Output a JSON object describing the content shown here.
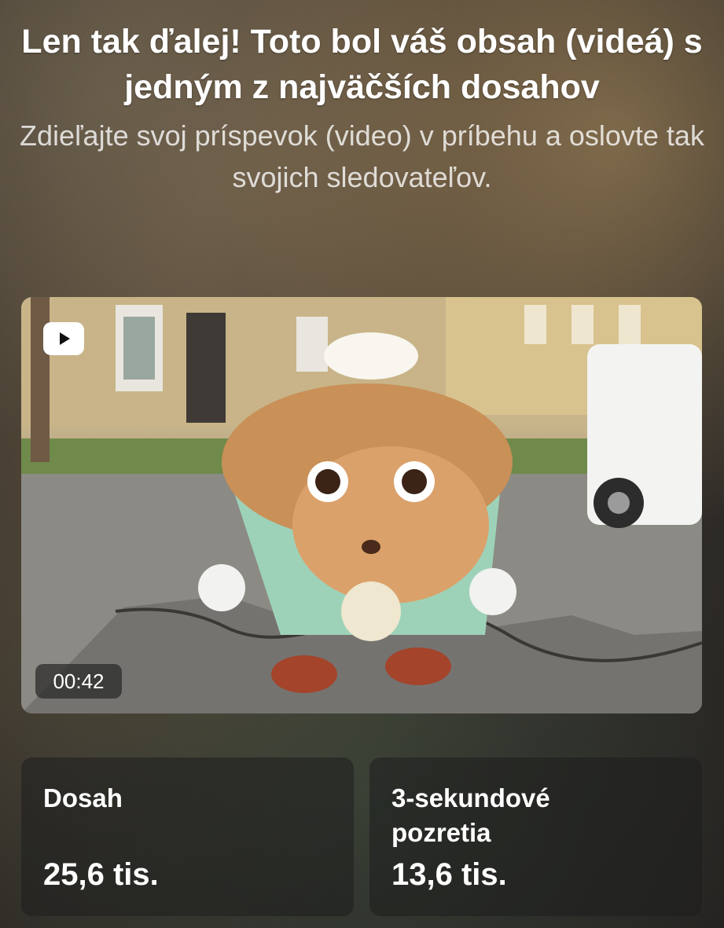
{
  "header": {
    "title": "Len tak ďalej! Toto bol váš obsah (videá) s jedným z najväčších dosahov",
    "subtitle": "Zdieľajte svoj príspevok (video) v príbehu a oslovte tak svojich sledovateľov."
  },
  "video": {
    "duration": "00:42",
    "type_icon": "video-play-icon"
  },
  "stats": [
    {
      "label": "Dosah",
      "value": "25,6 tis."
    },
    {
      "label": "3-sekundové pozretia",
      "value": "13,6 tis."
    }
  ]
}
